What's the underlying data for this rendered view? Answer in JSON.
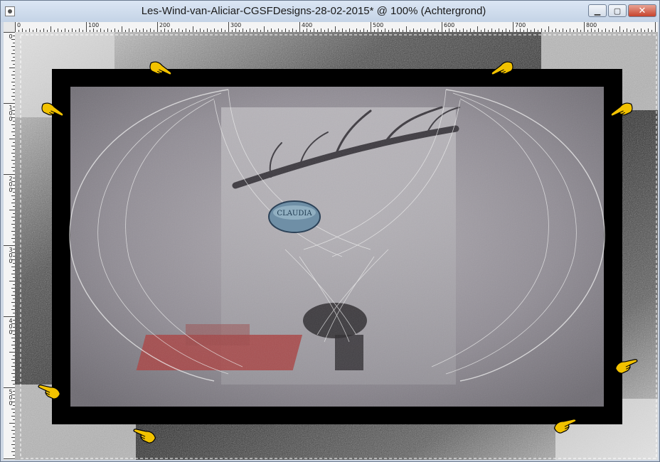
{
  "window": {
    "title": "Les-Wind-van-Aliciar-CGSFDesigns-28-02-2015* @ 100% (Achtergrond)",
    "controls": {
      "minimize": "▁",
      "maximize": "▢",
      "close": "✕"
    },
    "icon": "document-app-icon"
  },
  "ruler": {
    "horizontal": [
      "0",
      "100",
      "200",
      "300",
      "400",
      "500",
      "600",
      "700",
      "800"
    ],
    "vertical": [
      "0",
      "100",
      "200",
      "300",
      "400",
      "500"
    ]
  },
  "image": {
    "watermark": "CLAUDIA",
    "hand_icon": "pointing-hand-icon",
    "colors": {
      "frame": "#000000",
      "center": "#8e8a92",
      "bench": "#b04040",
      "hand": "#f2c200"
    }
  }
}
